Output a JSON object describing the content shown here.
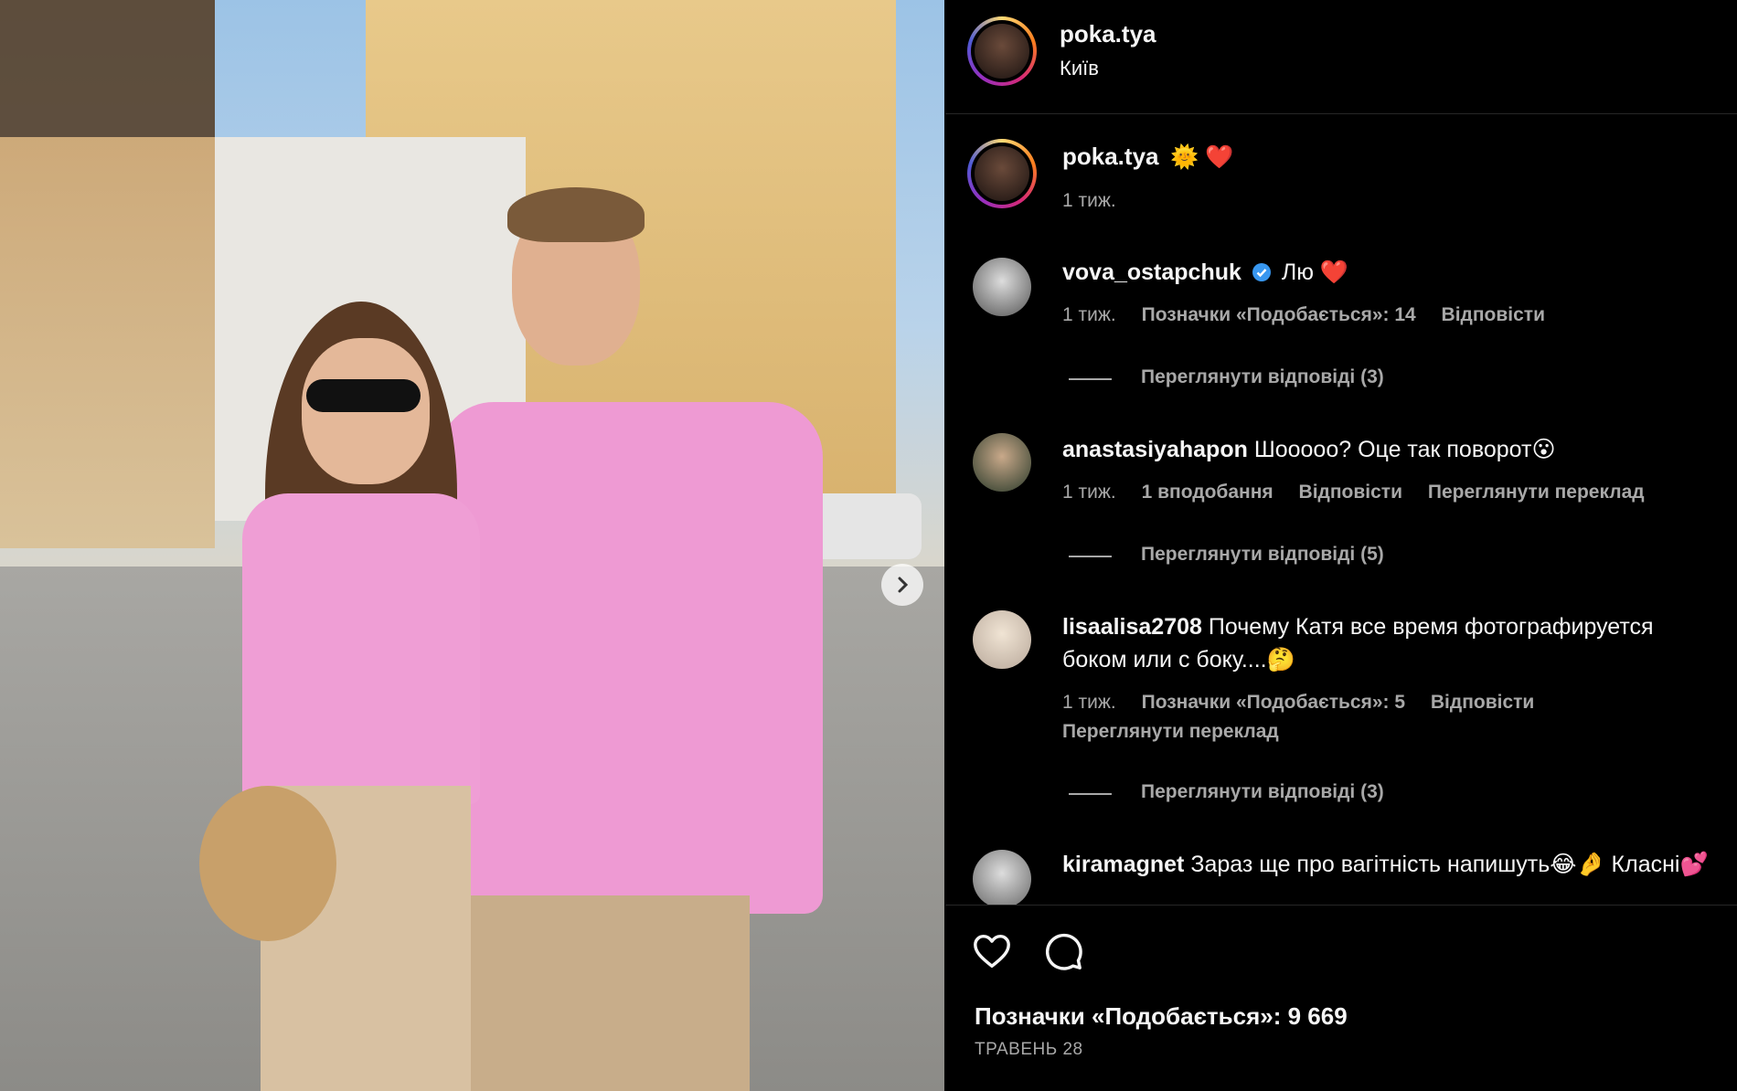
{
  "post": {
    "username": "poka.tya",
    "location": "Київ",
    "caption_emoji": "🌞 ❤️",
    "caption_time": "1 тиж.",
    "likes_label": "Позначки «Подобається»: 9 669",
    "date_label": "ТРАВЕНЬ 28"
  },
  "icons": {
    "like": "heart-outline-icon",
    "comment": "comment-bubble-icon",
    "next": "chevron-right-icon",
    "verified": "verified-badge-icon"
  },
  "comments": [
    {
      "user": "vova_ostapchuk",
      "verified": true,
      "text": "Лю ❤️",
      "time": "1 тиж.",
      "likes": "Позначки «Подобається»: 14",
      "reply": "Відповісти",
      "view_replies": "Переглянути відповіді (3)"
    },
    {
      "user": "anastasiyahapon",
      "text": "Шооооо? Оце так поворот😮",
      "time": "1 тиж.",
      "likes": "1 вподобання",
      "reply": "Відповісти",
      "translate": "Переглянути переклад",
      "view_replies": "Переглянути відповіді (5)"
    },
    {
      "user": "lisaalisa2708",
      "text": "Почему Катя все время фотографируется боком или с боку....🤔",
      "time": "1 тиж.",
      "likes": "Позначки «Подобається»: 5",
      "reply": "Відповісти",
      "translate": "Переглянути переклад",
      "view_replies": "Переглянути відповіді (3)"
    },
    {
      "user": "kiramagnet",
      "text": "Зараз ще про вагітність напишуть😂🤌 Класні💕"
    }
  ]
}
